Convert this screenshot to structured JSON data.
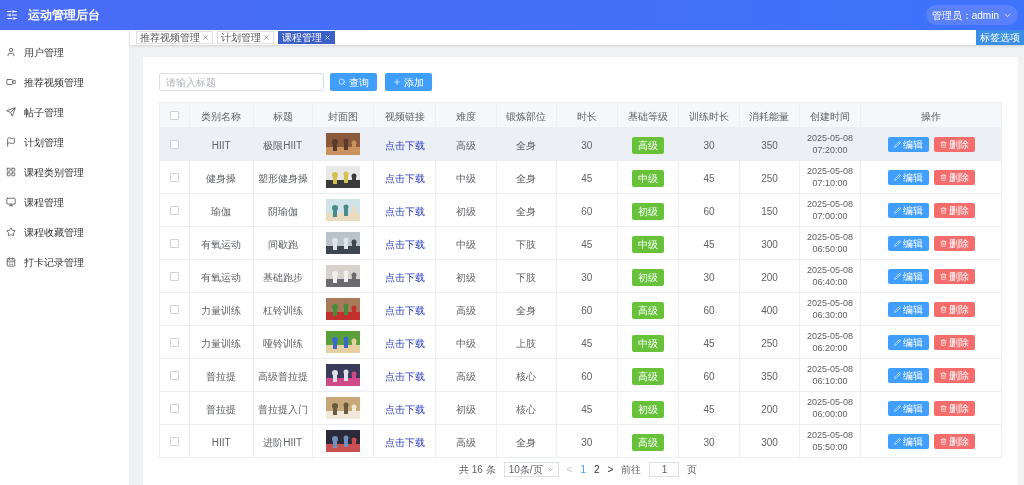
{
  "header": {
    "title": "运动管理后台",
    "user": "管理员：admin"
  },
  "sidebar": {
    "items": [
      {
        "label": "用户管理"
      },
      {
        "label": "推荐视频管理"
      },
      {
        "label": "帖子管理"
      },
      {
        "label": "计划管理"
      },
      {
        "label": "课程类别管理"
      },
      {
        "label": "课程管理"
      },
      {
        "label": "课程收藏管理"
      },
      {
        "label": "打卡记录管理"
      }
    ]
  },
  "tabs": [
    {
      "label": "推荐视频管理",
      "selected": false
    },
    {
      "label": "计划管理",
      "selected": false
    },
    {
      "label": "课程管理",
      "selected": true
    }
  ],
  "tab_options_button": "标签选项",
  "search": {
    "placeholder": "请输入标题"
  },
  "buttons": {
    "query": "查询",
    "add": "添加"
  },
  "table": {
    "select_all": {
      "checked": false
    },
    "columns": [
      "类别名称",
      "标题",
      "封面图",
      "视频链接",
      "难度",
      "锻炼部位",
      "时长",
      "基础等级",
      "训练时长",
      "消耗能量",
      "创建时间",
      "操作"
    ],
    "rows": [
      {
        "checked": false,
        "hovered": true,
        "category": "HIIT",
        "title": "极限HIIT",
        "link": "点击下载",
        "difficulty": "高级",
        "body_part": "全身",
        "duration": "30",
        "level_tag": "高级",
        "train_time": "30",
        "calories": "350",
        "created": "2025-05-08 07:20:00",
        "edit": "编辑",
        "delete": "删除"
      },
      {
        "checked": false,
        "hovered": false,
        "category": "健身操",
        "title": "塑形健身操",
        "link": "点击下载",
        "difficulty": "中级",
        "body_part": "全身",
        "duration": "45",
        "level_tag": "中级",
        "train_time": "45",
        "calories": "250",
        "created": "2025-05-08 07:10:00",
        "edit": "编辑",
        "delete": "删除"
      },
      {
        "checked": false,
        "hovered": false,
        "category": "瑜伽",
        "title": "阴瑜伽",
        "link": "点击下载",
        "difficulty": "初级",
        "body_part": "全身",
        "duration": "60",
        "level_tag": "初级",
        "train_time": "60",
        "calories": "150",
        "created": "2025-05-08 07:00:00",
        "edit": "编辑",
        "delete": "删除"
      },
      {
        "checked": false,
        "hovered": false,
        "category": "有氧运动",
        "title": "间歇跑",
        "link": "点击下载",
        "difficulty": "中级",
        "body_part": "下肢",
        "duration": "45",
        "level_tag": "中级",
        "train_time": "45",
        "calories": "300",
        "created": "2025-05-08 06:50:00",
        "edit": "编辑",
        "delete": "删除"
      },
      {
        "checked": false,
        "hovered": false,
        "category": "有氧运动",
        "title": "基础跑步",
        "link": "点击下载",
        "difficulty": "初级",
        "body_part": "下肢",
        "duration": "30",
        "level_tag": "初级",
        "train_time": "30",
        "calories": "200",
        "created": "2025-05-08 06:40:00",
        "edit": "编辑",
        "delete": "删除"
      },
      {
        "checked": false,
        "hovered": false,
        "category": "力量训练",
        "title": "杠铃训练",
        "link": "点击下载",
        "difficulty": "高级",
        "body_part": "全身",
        "duration": "60",
        "level_tag": "高级",
        "train_time": "60",
        "calories": "400",
        "created": "2025-05-08 06:30:00",
        "edit": "编辑",
        "delete": "删除"
      },
      {
        "checked": false,
        "hovered": false,
        "category": "力量训练",
        "title": "哑铃训练",
        "link": "点击下载",
        "difficulty": "中级",
        "body_part": "上肢",
        "duration": "45",
        "level_tag": "中级",
        "train_time": "45",
        "calories": "250",
        "created": "2025-05-08 06:20:00",
        "edit": "编辑",
        "delete": "删除"
      },
      {
        "checked": false,
        "hovered": false,
        "category": "普拉提",
        "title": "高级普拉提",
        "link": "点击下载",
        "difficulty": "高级",
        "body_part": "核心",
        "duration": "60",
        "level_tag": "高级",
        "train_time": "60",
        "calories": "350",
        "created": "2025-05-08 06:10:00",
        "edit": "编辑",
        "delete": "删除"
      },
      {
        "checked": false,
        "hovered": false,
        "category": "普拉提",
        "title": "普拉提入门",
        "link": "点击下载",
        "difficulty": "初级",
        "body_part": "核心",
        "duration": "45",
        "level_tag": "初级",
        "train_time": "45",
        "calories": "200",
        "created": "2025-05-08 06:00:00",
        "edit": "编辑",
        "delete": "删除"
      },
      {
        "checked": false,
        "hovered": false,
        "category": "HIIT",
        "title": "进阶HIIT",
        "link": "点击下载",
        "difficulty": "高级",
        "body_part": "全身",
        "duration": "30",
        "level_tag": "高级",
        "train_time": "30",
        "calories": "300",
        "created": "2025-05-08 05:50:00",
        "edit": "编辑",
        "delete": "删除"
      }
    ]
  },
  "pagination": {
    "total": "共 16 条",
    "page_size": "10条/页",
    "prev": "<",
    "pages": [
      {
        "label": "1",
        "selected": true
      },
      {
        "label": "2",
        "selected": false
      }
    ],
    "next": ">",
    "goto_label": "前往",
    "goto_value": "1",
    "goto_suffix": "页"
  }
}
